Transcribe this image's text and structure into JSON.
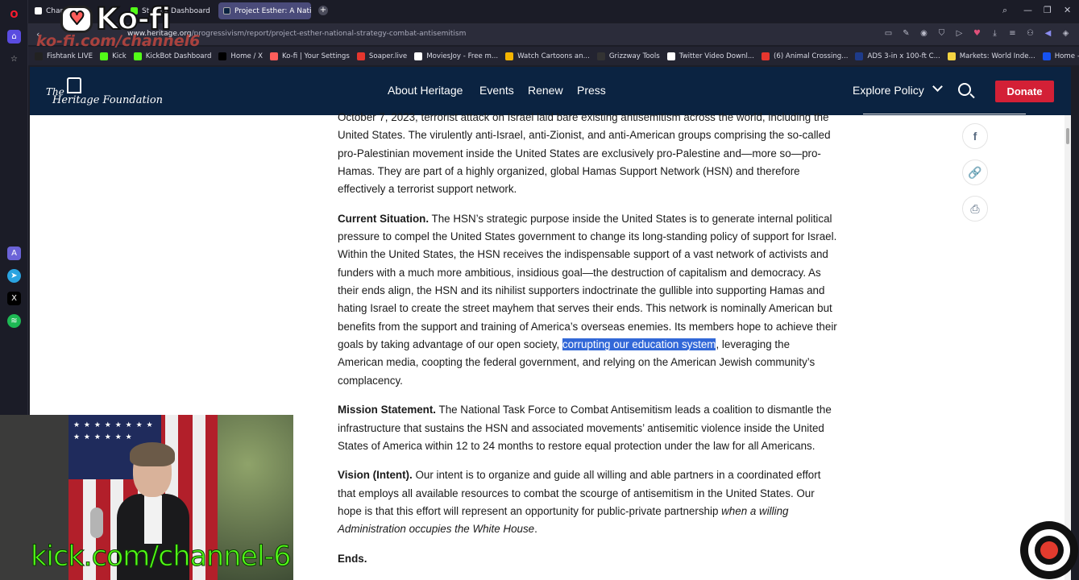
{
  "browser": {
    "tabs": [
      {
        "label": "Chan",
        "color": "#ffffff"
      },
      {
        "label": "Str",
        "color": "#53fc18"
      },
      {
        "label": "ck Dashboard",
        "color": "#53fc18"
      },
      {
        "label": "Project Esther: A National",
        "color": "#4a4b7a"
      }
    ],
    "new_tab": "+",
    "url_domain": "www.heritage.org",
    "url_path": "/progressivism/report/project-esther-national-strategy-combat-antisemitism",
    "bookmarks": [
      {
        "label": "Fishtank LIVE",
        "color": "#222222"
      },
      {
        "label": "Kick",
        "color": "#53fc18"
      },
      {
        "label": "KickBot Dashboard",
        "color": "#53fc18"
      },
      {
        "label": "Home / X",
        "color": "#000000"
      },
      {
        "label": "Ko-fi | Your Settings",
        "color": "#ff5e5b"
      },
      {
        "label": "Soaper.live",
        "color": "#e5362e"
      },
      {
        "label": "MoviesJoy - Free m...",
        "color": "#ffffff"
      },
      {
        "label": "Watch Cartoons an...",
        "color": "#f4b400"
      },
      {
        "label": "Grizzway Tools",
        "color": "#333333"
      },
      {
        "label": "Twitter Video Downl...",
        "color": "#ffffff"
      },
      {
        "label": "(6) Animal Crossing...",
        "color": "#e5362e"
      },
      {
        "label": "ADS 3-in x 100-ft C...",
        "color": "#1e3b8a"
      },
      {
        "label": "Markets: World Inde...",
        "color": "#f5d442"
      },
      {
        "label": "Home - Coinbase",
        "color": "#1652f0"
      }
    ]
  },
  "overlay": {
    "kofi_logo": "Ko-fi",
    "kofi_url": "ko-fi.com/channel6",
    "kick_url": "kick.com/channel-6"
  },
  "site": {
    "logo_line1": "The",
    "logo_line2": "Heritage Foundation",
    "nav": [
      "About Heritage",
      "Events",
      "Renew",
      "Press"
    ],
    "explore": "Explore Policy",
    "donate": "Donate",
    "share": {
      "facebook": "f",
      "link": "🔗",
      "print": "⎙"
    }
  },
  "article": {
    "p1": "October 7, 2023, terrorist attack on Israel laid bare existing antisemitism across the world, including the United States. The virulently anti-Israel, anti-Zionist, and anti-American groups comprising the so-called pro-Palestinian movement inside the United States are exclusively pro-Palestine and—more so—pro-Hamas. They are part of a highly organized, global Hamas Support Network (HSN) and therefore effectively a terrorist support network.",
    "current_label": "Current Situation.",
    "current_a": " The HSN’s strategic purpose inside the United States is to generate internal political pressure to compel the United States government to change its long-standing policy of support for Israel. Within the United States, the HSN receives the indispensable support of a vast network of activists and funders with a much more ambitious, insidious goal—the destruction of capitalism and democracy. As their ends align, the HSN and its nihilist supporters indoctrinate the gullible into supporting Hamas and hating Israel to create the street mayhem that serves their ends. This network is nominally American but benefits from the support and training of America’s overseas enemies. Its members hope to achieve their goals by taking advantage of our open society, ",
    "current_highlight": "corrupting our education system",
    "current_b": ", leveraging the American media, coopting the federal government, and relying on the American Jewish community’s complacency.",
    "mission_label": "Mission Statement.",
    "mission": " The National Task Force to Combat Antisemitism leads a coalition to dismantle the infrastructure that sustains the HSN and associated movements’ antisemitic violence inside the United States of America within 12 to 24 months to restore equal protection under the law for all Americans.",
    "vision_label": "Vision (Intent).",
    "vision": " Our intent is to organize and guide all willing and able partners in a coordinated effort that employs all available resources to combat the scourge of antisemitism in the United States. Our hope is that this effort will represent an opportunity for public-private partnership ",
    "vision_italic": "when a willing Administration occupies the White House",
    "vision_end": ".",
    "next_heading": "Ends."
  }
}
